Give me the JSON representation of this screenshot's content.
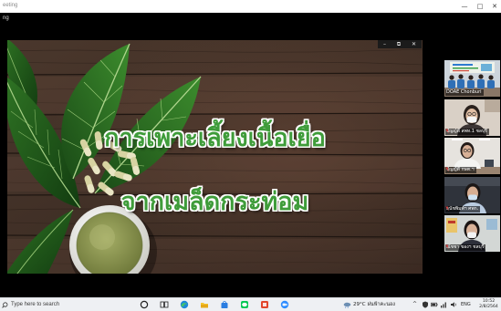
{
  "window": {
    "title": "eeting",
    "minimize_glyph": "—",
    "maximize_glyph": "□",
    "close_glyph": "✕"
  },
  "menu": {
    "label": "ng"
  },
  "share": {
    "controls": {
      "minimize_glyph": "–",
      "restore_glyph": "⧉",
      "close_glyph": "✕"
    },
    "slide": {
      "line1": "การเพาะเลี้ยงเนื้อเยื่อ",
      "line2": "จากเมล็ดกระท่อม"
    }
  },
  "participants": [
    {
      "name": "DOAE Chonburi",
      "active_speaker": true,
      "muted": false
    },
    {
      "name": "ปัญญ์ดี สพท.1 ชลบุรี",
      "active_speaker": false,
      "muted": true
    },
    {
      "name": "ปัญญ์ดี กษต.ฯ",
      "active_speaker": false,
      "muted": true
    },
    {
      "name": "ธนัชพิมพ์ฯ ศพก.",
      "active_speaker": false,
      "muted": true
    },
    {
      "name": "ณัชชา ของฯ ชลบุรี",
      "active_speaker": false,
      "muted": true
    }
  ],
  "taskbar": {
    "search_placeholder": "Type here to search",
    "apps": [
      {
        "icon": "cortana-icon"
      },
      {
        "icon": "task-view-icon"
      },
      {
        "icon": "edge-icon"
      },
      {
        "icon": "file-explorer-icon"
      },
      {
        "icon": "store-icon"
      },
      {
        "icon": "line-app-icon"
      },
      {
        "icon": "office-icon"
      },
      {
        "icon": "zoom-icon"
      }
    ],
    "weather": {
      "icon": "cloud-rain-icon",
      "temperature": "29°C",
      "condition": "ฝนฟ้าคะนอง"
    },
    "tray_chevron": "^",
    "language": "ENG",
    "time": "10:52",
    "date": "2/8/2564"
  },
  "colors": {
    "slide_text": "#3f9c3a",
    "slide_text_outline": "#ffffff",
    "active_speaker_border": "#6fcf52",
    "muted_icon": "#e04545"
  }
}
